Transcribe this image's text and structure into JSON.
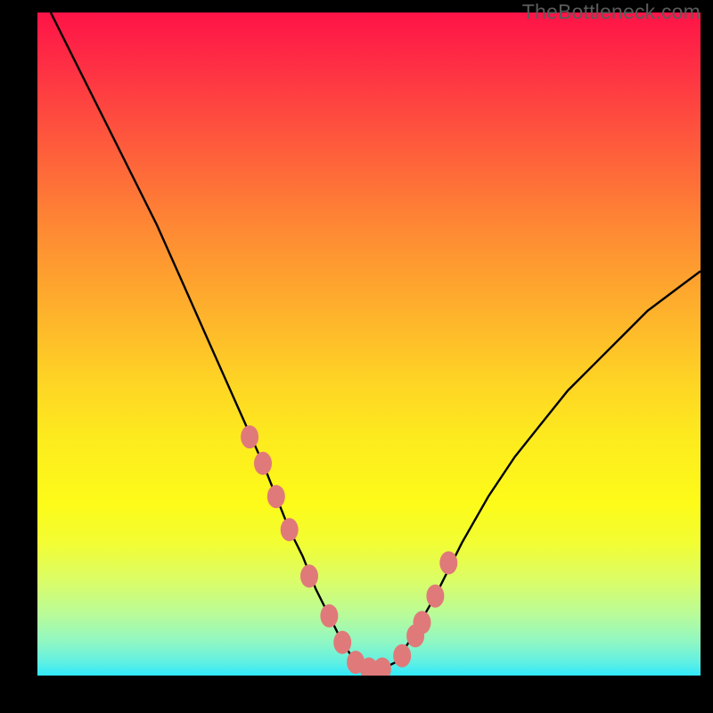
{
  "watermark": "TheBottleneck.com",
  "colors": {
    "frame": "#000000",
    "curve_stroke": "#000000",
    "marker_fill": "#e07a7a",
    "marker_stroke": "#d46a6a",
    "gradient_top": "#fe1347",
    "gradient_bottom": "#30e9fb"
  },
  "chart_data": {
    "type": "line",
    "title": "",
    "xlabel": "",
    "ylabel": "",
    "xlim": [
      0,
      100
    ],
    "ylim": [
      0,
      100
    ],
    "grid": false,
    "legend": false,
    "series": [
      {
        "name": "bottleneck-curve",
        "x": [
          2,
          6,
          10,
          14,
          18,
          22,
          26,
          30,
          34,
          38,
          40,
          42,
          44,
          46,
          48,
          50,
          52,
          54,
          56,
          60,
          64,
          68,
          72,
          76,
          80,
          84,
          88,
          92,
          96,
          100
        ],
        "y": [
          100,
          92,
          84,
          76,
          68,
          59,
          50,
          41,
          32,
          22,
          18,
          13,
          9,
          5,
          2,
          1,
          1,
          2,
          5,
          12,
          20,
          27,
          33,
          38,
          43,
          47,
          51,
          55,
          58,
          61
        ]
      }
    ],
    "markers": {
      "name": "highlighted-points",
      "x": [
        32,
        34,
        36,
        38,
        41,
        44,
        46,
        48,
        50,
        52,
        55,
        57,
        58,
        60,
        62
      ],
      "y": [
        36,
        32,
        27,
        22,
        15,
        9,
        5,
        2,
        1,
        1,
        3,
        6,
        8,
        12,
        17
      ]
    },
    "annotations": []
  }
}
